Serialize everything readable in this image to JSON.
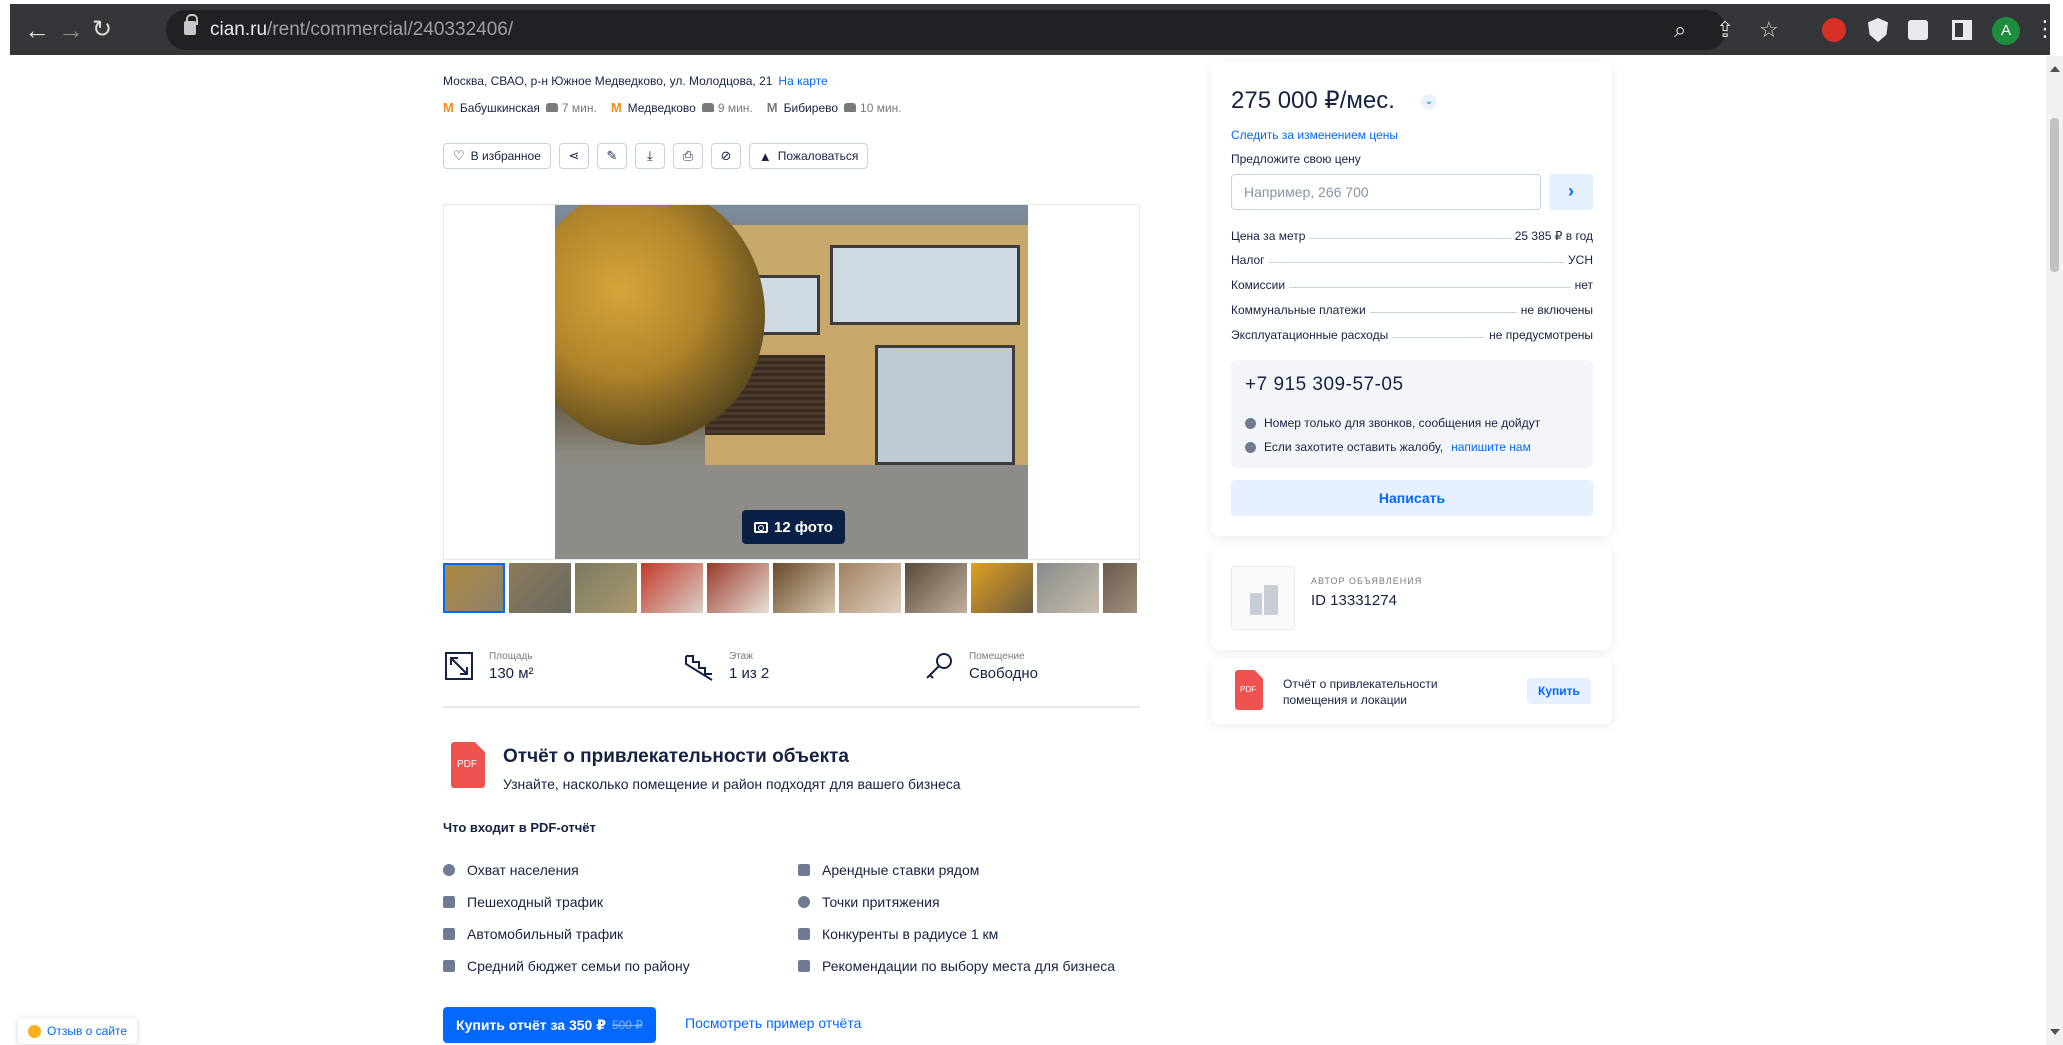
{
  "browser": {
    "url_host": "cian.ru",
    "url_path": "/rent/commercial/240332406/",
    "profile_initial": "A"
  },
  "listing": {
    "address": "Москва, СВАО, р-н Южное Медведково, ул. Молодцова, 21",
    "map_link": "На карте",
    "metro": [
      {
        "name": "Бабушкинская",
        "time": "7 мин.",
        "line_color": "#f58a1f"
      },
      {
        "name": "Медведково",
        "time": "9 мин.",
        "line_color": "#f58a1f"
      },
      {
        "name": "Бибирево",
        "time": "10 мин.",
        "line_color": "#7a7a7a"
      }
    ],
    "actions": {
      "favorite": "В избранное",
      "report": "Пожаловаться"
    },
    "photo_count": "12 фото",
    "facts": [
      {
        "label": "Площадь",
        "value": "130 м²",
        "icon": "area-icon"
      },
      {
        "label": "Этаж",
        "value": "1 из 2",
        "icon": "stairs-icon"
      },
      {
        "label": "Помещение",
        "value": "Свободно",
        "icon": "key-icon"
      }
    ]
  },
  "report": {
    "title": "Отчёт о привлекательности объекта",
    "subtitle": "Узнайте, насколько помещение и район подходят для вашего бизнеса",
    "includes_title": "Что входит в PDF-отчёт",
    "features_left": [
      "Охват населения",
      "Пешеходный трафик",
      "Автомобильный трафик",
      "Средний бюджет семьи по району"
    ],
    "features_right": [
      "Арендные ставки рядом",
      "Точки притяжения",
      "Конкуренты в радиусе 1 км",
      "Рекомендации по выбору места для бизнеса"
    ],
    "buy_label": "Купить отчёт за 350 ₽",
    "buy_old_price": "500 ₽",
    "sample_link": "Посмотреть пример отчёта"
  },
  "feedback": "Отзыв о сайте",
  "price_card": {
    "price": "275 000 ₽/мес.",
    "follow_link": "Следить за изменением цены",
    "offer_label": "Предложите свою цену",
    "offer_placeholder": "Например, 266 700",
    "terms": [
      {
        "key": "Цена за метр",
        "value": "25 385 ₽ в год"
      },
      {
        "key": "Налог",
        "value": "УСН"
      },
      {
        "key": "Комиссии",
        "value": "нет"
      },
      {
        "key": "Коммунальные платежи",
        "value": "не включены"
      },
      {
        "key": "Эксплуатационные расходы",
        "value": "не предусмотрены"
      }
    ],
    "phone": "+7 915 309-57-05",
    "phone_note": "Номер только для звонков, сообщения не дойдут",
    "complaint_note": "Если захотите оставить жалобу,",
    "complaint_link": "напишите нам",
    "write_button": "Написать"
  },
  "author": {
    "label": "АВТОР ОБЪЯВЛЕНИЯ",
    "id": "ID 13331274"
  },
  "pdf_promo": {
    "text": "Отчёт о привлекательности помещения и локации",
    "buy": "Купить"
  },
  "colors": {
    "accent": "#0468ff",
    "text": "#152242",
    "metro_orange": "#f58a1f"
  }
}
